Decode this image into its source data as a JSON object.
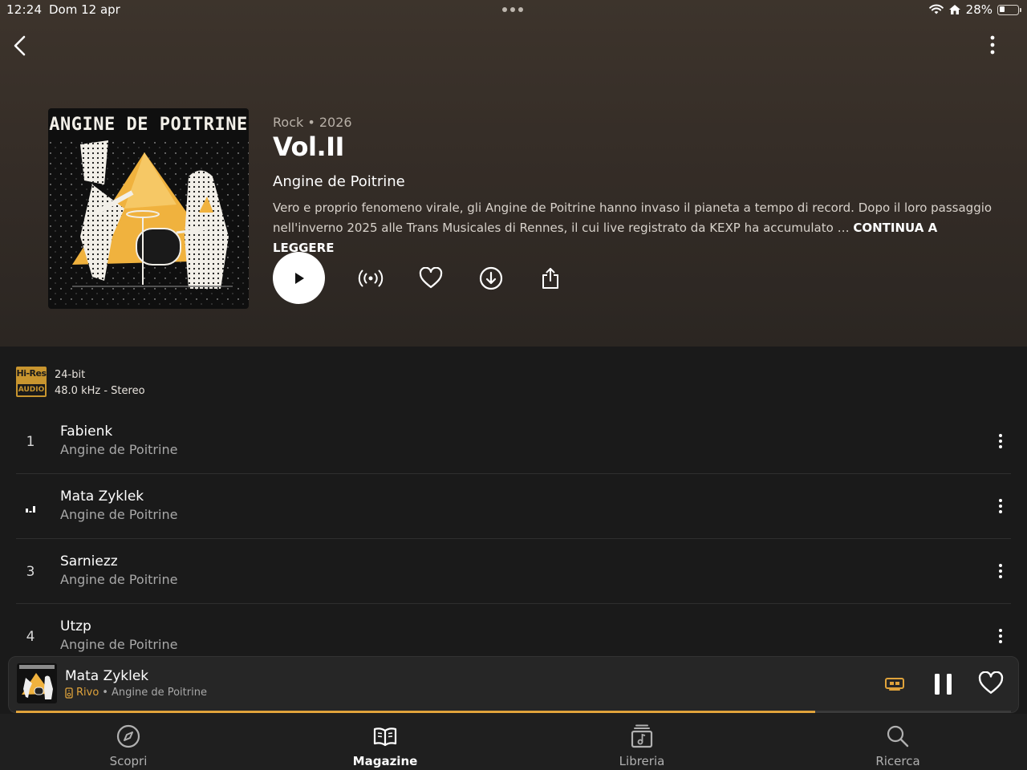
{
  "status_bar": {
    "time": "12:24",
    "date": "Dom 12 apr",
    "battery": "28%",
    "battery_level": 0.28
  },
  "album": {
    "cover_text": "ANGINE DE POITRINE",
    "meta": "Rock • 2026",
    "title": "Vol.II",
    "artist": "Angine de Poitrine",
    "description": "Vero e proprio fenomeno virale, gli Angine de Poitrine hanno invaso il pianeta a tempo di record. Dopo il loro passaggio nell'inverno 2025 alle Trans Musicales di Rennes, il cui live registrato da KEXP ha accumulato …",
    "read_more": "CONTINUA A LEGGERE"
  },
  "actions": {
    "play": "play-icon",
    "radio": "radio-broadcast-icon",
    "favorite": "heart-icon",
    "download": "download-icon",
    "share": "share-icon"
  },
  "quality": {
    "badge_top": "Hi-Res",
    "badge_bottom": "AUDIO",
    "bit_depth": "24-bit",
    "sample_rate": "48.0 kHz - Stereo"
  },
  "tracks": [
    {
      "number": "1",
      "title": "Fabienk",
      "artist": "Angine de Poitrine",
      "playing": false
    },
    {
      "number": "2",
      "title": "Mata Zyklek",
      "artist": "Angine de Poitrine",
      "playing": true
    },
    {
      "number": "3",
      "title": "Sarniezz",
      "artist": "Angine de Poitrine",
      "playing": false
    },
    {
      "number": "4",
      "title": "Utzp",
      "artist": "Angine de Poitrine",
      "playing": false
    }
  ],
  "now_playing": {
    "title": "Mata Zyklek",
    "source": "Rivo",
    "artist": "Angine de Poitrine",
    "separator": "•",
    "progress": 0.803
  },
  "tabs": [
    {
      "label": "Scopri",
      "icon": "compass-icon",
      "active": false
    },
    {
      "label": "Magazine",
      "icon": "book-icon",
      "active": true
    },
    {
      "label": "Libreria",
      "icon": "library-icon",
      "active": false
    },
    {
      "label": "Ricerca",
      "icon": "search-icon",
      "active": false
    }
  ],
  "colors": {
    "accent": "#e0a33b",
    "background": "#1a1a1a",
    "header": "#3d342c"
  }
}
